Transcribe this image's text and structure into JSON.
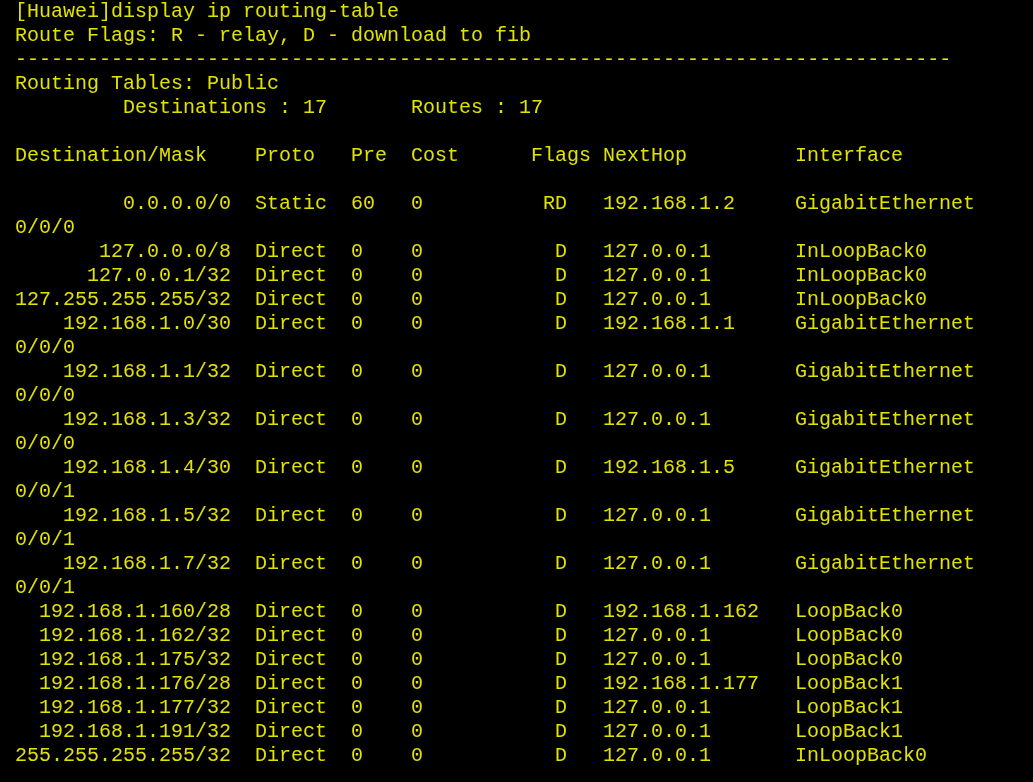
{
  "terminal": {
    "command": "[Huawei]display ip routing-table",
    "flags_legend": "Route Flags: R - relay, D - download to fib",
    "separator": "------------------------------------------------------------------------------",
    "table_title": "Routing Tables: Public",
    "destinations": "Destinations : 17",
    "routes": "Routes : 17"
  },
  "table": {
    "columns": [
      "Destination/Mask",
      "Proto",
      "Pre",
      "Cost",
      "Flags",
      "NextHop",
      "Interface"
    ],
    "rows": [
      {
        "destination": "0.0.0.0/0",
        "proto": "Static",
        "pre": "60",
        "cost": "0",
        "flags": "RD",
        "nexthop": "192.168.1.2",
        "interface": "GigabitEthernet",
        "interface_wrap": "0/0/0"
      },
      {
        "destination": "127.0.0.0/8",
        "proto": "Direct",
        "pre": "0",
        "cost": "0",
        "flags": "D",
        "nexthop": "127.0.0.1",
        "interface": "InLoopBack0"
      },
      {
        "destination": "127.0.0.1/32",
        "proto": "Direct",
        "pre": "0",
        "cost": "0",
        "flags": "D",
        "nexthop": "127.0.0.1",
        "interface": "InLoopBack0"
      },
      {
        "destination": "127.255.255.255/32",
        "proto": "Direct",
        "pre": "0",
        "cost": "0",
        "flags": "D",
        "nexthop": "127.0.0.1",
        "interface": "InLoopBack0"
      },
      {
        "destination": "192.168.1.0/30",
        "proto": "Direct",
        "pre": "0",
        "cost": "0",
        "flags": "D",
        "nexthop": "192.168.1.1",
        "interface": "GigabitEthernet",
        "interface_wrap": "0/0/0"
      },
      {
        "destination": "192.168.1.1/32",
        "proto": "Direct",
        "pre": "0",
        "cost": "0",
        "flags": "D",
        "nexthop": "127.0.0.1",
        "interface": "GigabitEthernet",
        "interface_wrap": "0/0/0"
      },
      {
        "destination": "192.168.1.3/32",
        "proto": "Direct",
        "pre": "0",
        "cost": "0",
        "flags": "D",
        "nexthop": "127.0.0.1",
        "interface": "GigabitEthernet",
        "interface_wrap": "0/0/0"
      },
      {
        "destination": "192.168.1.4/30",
        "proto": "Direct",
        "pre": "0",
        "cost": "0",
        "flags": "D",
        "nexthop": "192.168.1.5",
        "interface": "GigabitEthernet",
        "interface_wrap": "0/0/1"
      },
      {
        "destination": "192.168.1.5/32",
        "proto": "Direct",
        "pre": "0",
        "cost": "0",
        "flags": "D",
        "nexthop": "127.0.0.1",
        "interface": "GigabitEthernet",
        "interface_wrap": "0/0/1"
      },
      {
        "destination": "192.168.1.7/32",
        "proto": "Direct",
        "pre": "0",
        "cost": "0",
        "flags": "D",
        "nexthop": "127.0.0.1",
        "interface": "GigabitEthernet",
        "interface_wrap": "0/0/1"
      },
      {
        "destination": "192.168.1.160/28",
        "proto": "Direct",
        "pre": "0",
        "cost": "0",
        "flags": "D",
        "nexthop": "192.168.1.162",
        "interface": "LoopBack0"
      },
      {
        "destination": "192.168.1.162/32",
        "proto": "Direct",
        "pre": "0",
        "cost": "0",
        "flags": "D",
        "nexthop": "127.0.0.1",
        "interface": "LoopBack0"
      },
      {
        "destination": "192.168.1.175/32",
        "proto": "Direct",
        "pre": "0",
        "cost": "0",
        "flags": "D",
        "nexthop": "127.0.0.1",
        "interface": "LoopBack0"
      },
      {
        "destination": "192.168.1.176/28",
        "proto": "Direct",
        "pre": "0",
        "cost": "0",
        "flags": "D",
        "nexthop": "192.168.1.177",
        "interface": "LoopBack1"
      },
      {
        "destination": "192.168.1.177/32",
        "proto": "Direct",
        "pre": "0",
        "cost": "0",
        "flags": "D",
        "nexthop": "127.0.0.1",
        "interface": "LoopBack1"
      },
      {
        "destination": "192.168.1.191/32",
        "proto": "Direct",
        "pre": "0",
        "cost": "0",
        "flags": "D",
        "nexthop": "127.0.0.1",
        "interface": "LoopBack1"
      },
      {
        "destination": "255.255.255.255/32",
        "proto": "Direct",
        "pre": "0",
        "cost": "0",
        "flags": "D",
        "nexthop": "127.0.0.1",
        "interface": "InLoopBack0"
      }
    ]
  }
}
